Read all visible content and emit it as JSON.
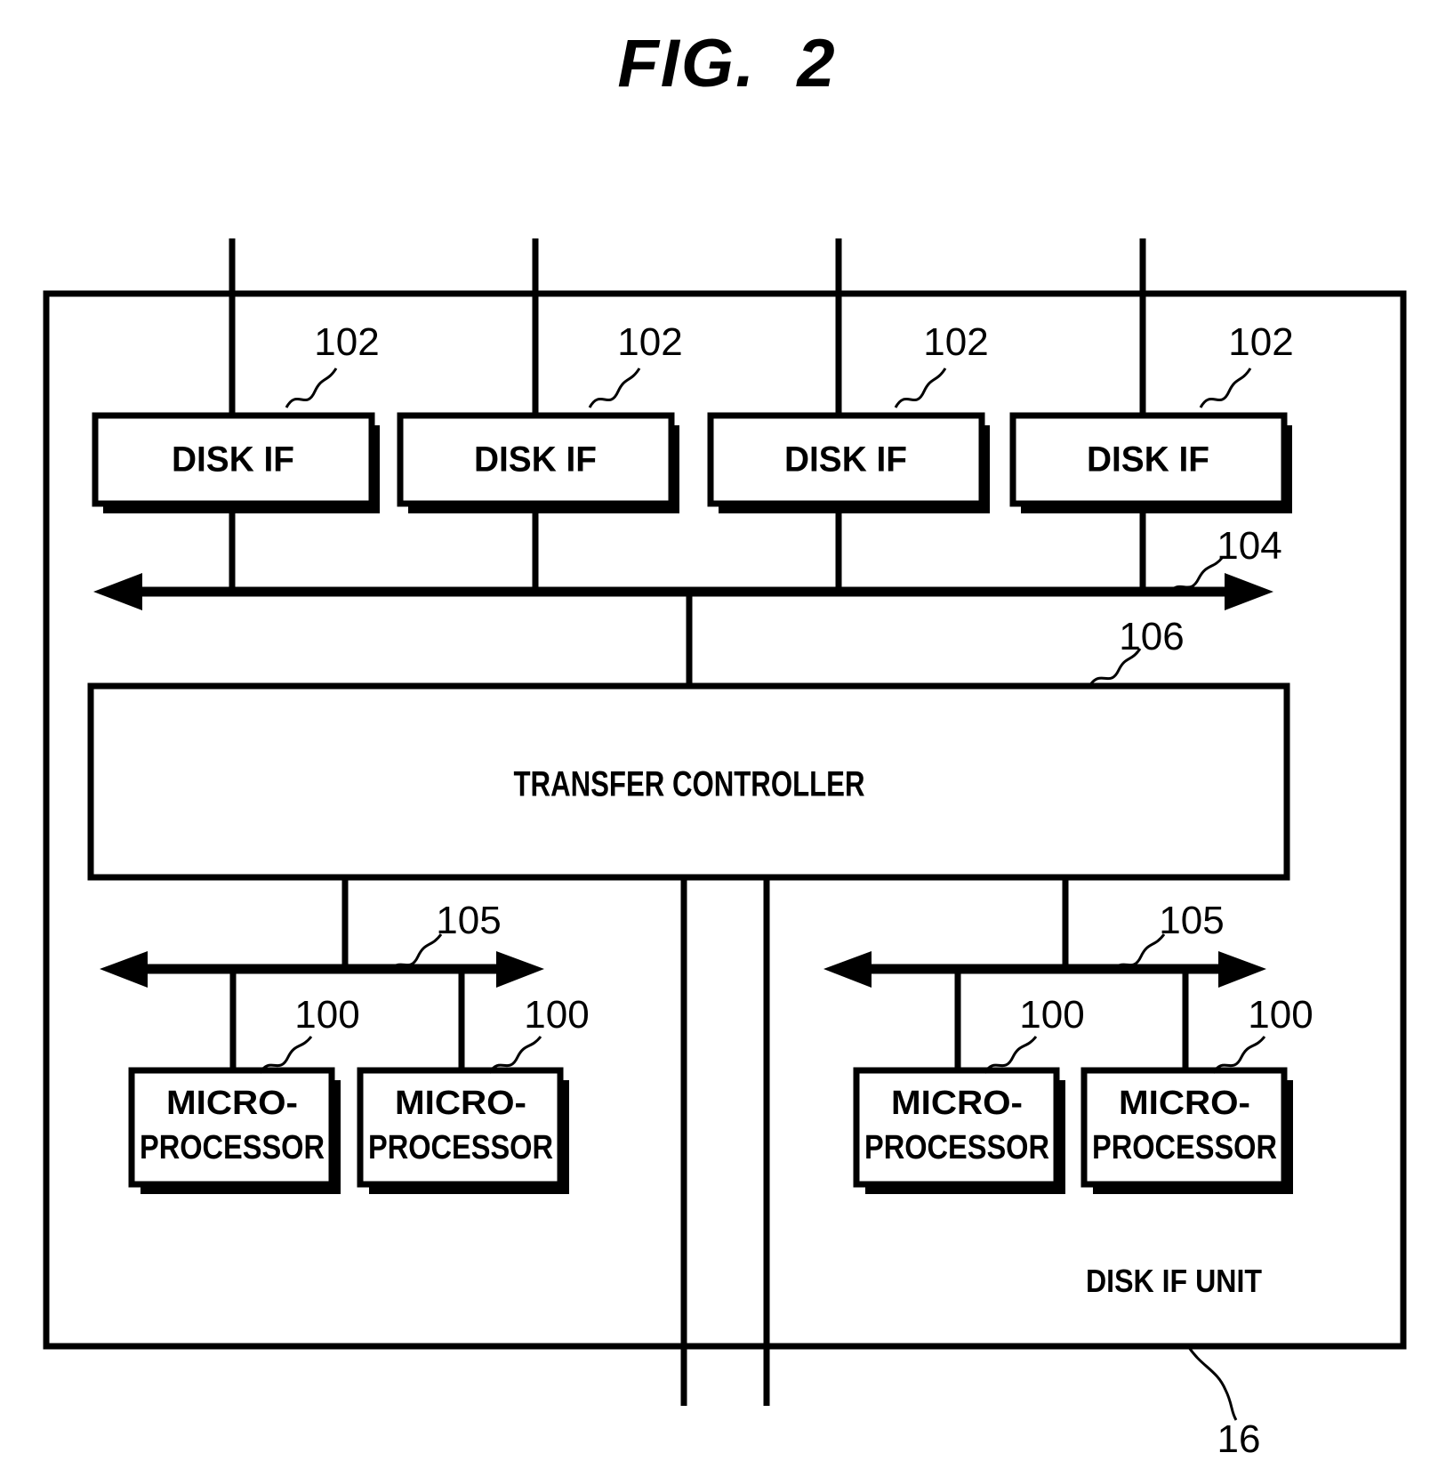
{
  "figure": {
    "title": "FIG.  2",
    "unit_label": "DISK IF UNIT",
    "unit_ref": "16"
  },
  "disk_ifs": [
    {
      "label": "DISK IF",
      "ref": "102"
    },
    {
      "label": "DISK IF",
      "ref": "102"
    },
    {
      "label": "DISK IF",
      "ref": "102"
    },
    {
      "label": "DISK IF",
      "ref": "102"
    }
  ],
  "upper_bus": {
    "ref": "104"
  },
  "controller": {
    "label": "TRANSFER CONTROLLER",
    "ref": "106"
  },
  "processor_buses": [
    {
      "ref": "105"
    },
    {
      "ref": "105"
    }
  ],
  "microprocessors": [
    {
      "line1": "MICRO-",
      "line2": "PROCESSOR",
      "ref": "100"
    },
    {
      "line1": "MICRO-",
      "line2": "PROCESSOR",
      "ref": "100"
    },
    {
      "line1": "MICRO-",
      "line2": "PROCESSOR",
      "ref": "100"
    },
    {
      "line1": "MICRO-",
      "line2": "PROCESSOR",
      "ref": "100"
    }
  ],
  "colors": {
    "ink": "#000000",
    "paper": "#ffffff"
  }
}
